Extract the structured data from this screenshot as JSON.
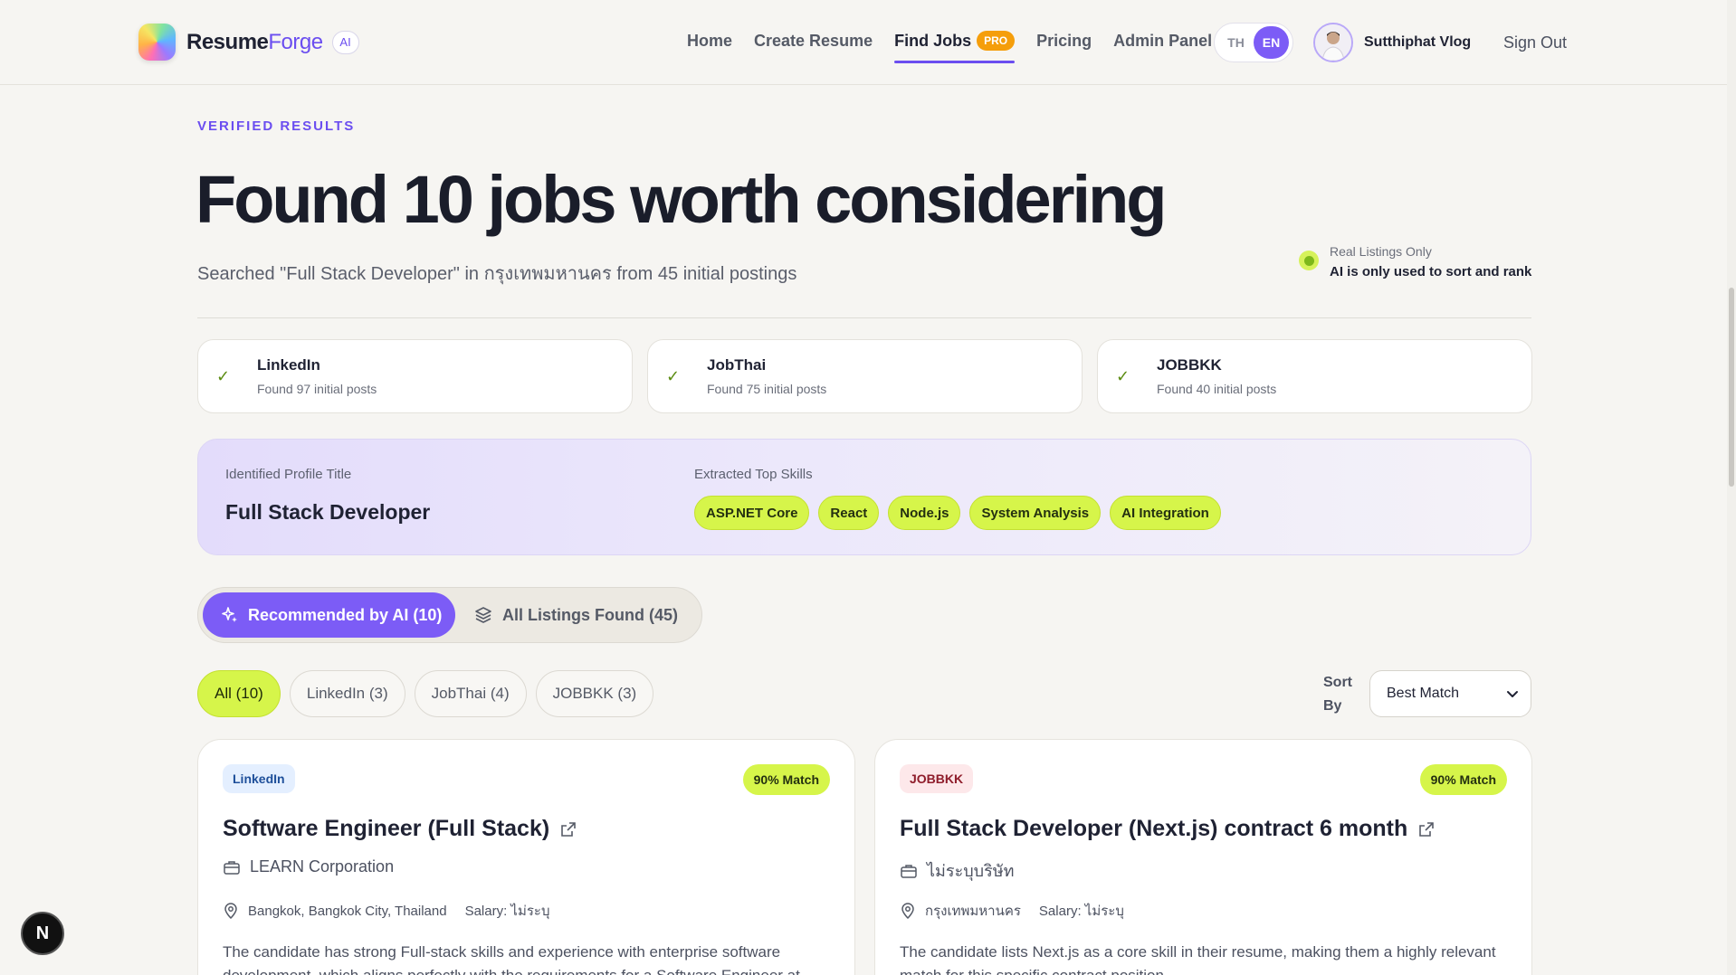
{
  "header": {
    "logo_main": "Resume",
    "logo_accent": "Forge",
    "logo_badge": "AI",
    "nav": [
      {
        "label": "Home"
      },
      {
        "label": "Create Resume"
      },
      {
        "label": "Find Jobs",
        "badge": "PRO",
        "active": true
      },
      {
        "label": "Pricing"
      },
      {
        "label": "Admin Panel"
      }
    ],
    "lang": {
      "th": "TH",
      "en": "EN",
      "selected": "EN"
    },
    "user_name": "Sutthiphat Vlog",
    "sign_out": "Sign Out"
  },
  "main": {
    "eyebrow": "VERIFIED RESULTS",
    "headline": "Found 10 jobs worth considering",
    "subline": "Searched \"Full Stack Developer\" in กรุงเทพมหานคร from 45 initial postings",
    "real_listings": {
      "top": "Real Listings Only",
      "bottom": "AI is only used to sort and rank"
    },
    "sources": [
      {
        "name": "LinkedIn",
        "count": "Found 97 initial posts"
      },
      {
        "name": "JobThai",
        "count": "Found 75 initial posts"
      },
      {
        "name": "JOBBKK",
        "count": "Found 40 initial posts"
      }
    ],
    "profile": {
      "title_label": "Identified Profile Title",
      "title": "Full Stack Developer",
      "skills_label": "Extracted Top Skills",
      "skills": [
        "ASP.NET Core",
        "React",
        "Node.js",
        "System Analysis",
        "AI Integration"
      ]
    },
    "tabs": {
      "recommended": "Recommended by AI (10)",
      "all": "All Listings Found (45)"
    },
    "filters": [
      "All (10)",
      "LinkedIn (3)",
      "JobThai (4)",
      "JOBBKK (3)"
    ],
    "sort": {
      "label": "Sort By",
      "value": "Best Match"
    },
    "jobs": [
      {
        "source": "LinkedIn",
        "match": "90% Match",
        "title": "Software Engineer (Full Stack)",
        "company": "LEARN Corporation",
        "location": "Bangkok, Bangkok City, Thailand",
        "salary": "Salary: ไม่ระบุ",
        "description": "The candidate has strong Full-stack skills and experience with enterprise software development, which aligns perfectly with the requirements for a Software Engineer at"
      },
      {
        "source": "JOBBKK",
        "match": "90% Match",
        "title": "Full Stack Developer (Next.js) contract 6 month",
        "company": "ไม่ระบุบริษัท",
        "location": "กรุงเทพมหานคร",
        "salary": "Salary: ไม่ระบุ",
        "description": "The candidate lists Next.js as a core skill in their resume, making them a highly relevant match for this specific contract position."
      }
    ]
  },
  "floating_badge": "N",
  "colors": {
    "accent": "#7c5cf6",
    "lime": "#d6f54a",
    "pro": "#f59e0b"
  }
}
